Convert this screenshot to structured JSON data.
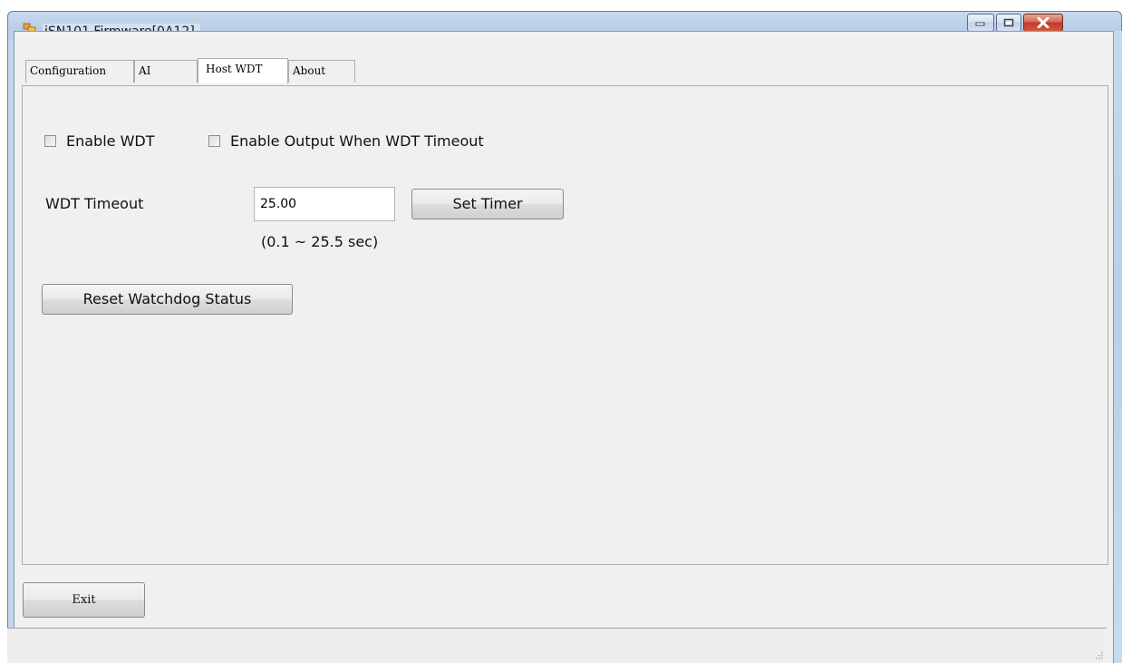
{
  "window": {
    "title": "iSN101 Firmware[0A12]"
  },
  "tabs": [
    {
      "label": "Configuration"
    },
    {
      "label": "AI"
    },
    {
      "label": "Host WDT"
    },
    {
      "label": "About"
    }
  ],
  "host_wdt": {
    "enable_wdt_label": "Enable WDT",
    "enable_output_label": "Enable Output When WDT Timeout",
    "timeout_label": "WDT Timeout",
    "timeout_value": "25.00",
    "set_timer_label": "Set Timer",
    "range_hint": "(0.1 ~ 25.5 sec)",
    "reset_label": "Reset Watchdog Status"
  },
  "footer": {
    "exit_label": "Exit"
  },
  "colors": {
    "titlebar": "#bcd1e9",
    "client_bg": "#f0f0f0",
    "close_button": "#c0392b"
  },
  "icons": {
    "app": "app-window-icon",
    "minimize": "minimize-icon",
    "maximize": "maximize-icon",
    "close": "close-icon"
  }
}
